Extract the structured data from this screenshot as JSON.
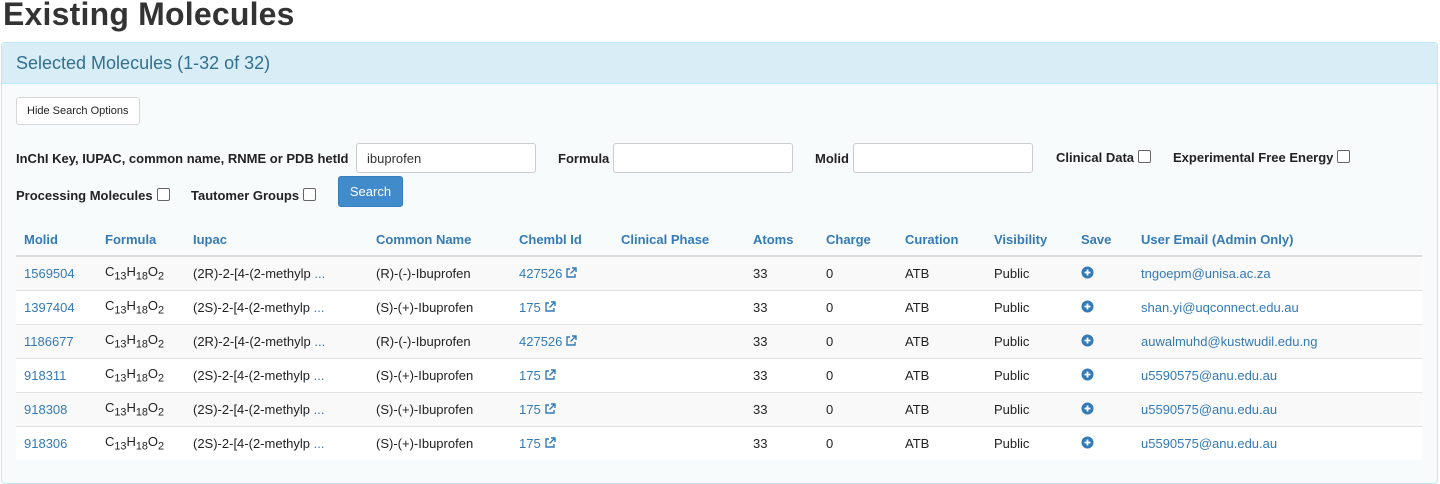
{
  "page_title": "Existing Molecules",
  "panel": {
    "heading": "Selected Molecules (1-32 of 32)"
  },
  "search": {
    "hide_button": "Hide Search Options",
    "query_label": "InChI Key, IUPAC, common name, RNME or PDB hetId",
    "query_value": "ibuprofen",
    "formula_label": "Formula",
    "formula_value": "",
    "molid_label": "Molid",
    "molid_value": "",
    "clinical_label": "Clinical Data",
    "free_energy_label": "Experimental Free Energy",
    "processing_label": "Processing Molecules",
    "tautomer_label": "Tautomer Groups",
    "search_button": "Search"
  },
  "table": {
    "headers": [
      "Molid",
      "Formula",
      "Iupac",
      "Common Name",
      "Chembl Id",
      "Clinical Phase",
      "Atoms",
      "Charge",
      "Curation",
      "Visibility",
      "Save",
      "User Email (Admin Only)"
    ],
    "rows": [
      {
        "molid": "1569504",
        "iupac": "(2R)-2-[4-(2-methylp",
        "common": "(R)-(-)-Ibuprofen",
        "chembl": "427526",
        "phase": "",
        "atoms": "33",
        "charge": "0",
        "curation": "ATB",
        "visibility": "Public",
        "email": "tngoepm@unisa.ac.za"
      },
      {
        "molid": "1397404",
        "iupac": "(2S)-2-[4-(2-methylp",
        "common": "(S)-(+)-Ibuprofen",
        "chembl": "175",
        "phase": "",
        "atoms": "33",
        "charge": "0",
        "curation": "ATB",
        "visibility": "Public",
        "email": "shan.yi@uqconnect.edu.au"
      },
      {
        "molid": "1186677",
        "iupac": "(2R)-2-[4-(2-methylp",
        "common": "(R)-(-)-Ibuprofen",
        "chembl": "427526",
        "phase": "",
        "atoms": "33",
        "charge": "0",
        "curation": "ATB",
        "visibility": "Public",
        "email": "auwalmuhd@kustwudil.edu.ng"
      },
      {
        "molid": "918311",
        "iupac": "(2S)-2-[4-(2-methylp",
        "common": "(S)-(+)-Ibuprofen",
        "chembl": "175",
        "phase": "",
        "atoms": "33",
        "charge": "0",
        "curation": "ATB",
        "visibility": "Public",
        "email": "u5590575@anu.edu.au"
      },
      {
        "molid": "918308",
        "iupac": "(2S)-2-[4-(2-methylp",
        "common": "(S)-(+)-Ibuprofen",
        "chembl": "175",
        "phase": "",
        "atoms": "33",
        "charge": "0",
        "curation": "ATB",
        "visibility": "Public",
        "email": "u5590575@anu.edu.au"
      },
      {
        "molid": "918306",
        "iupac": "(2S)-2-[4-(2-methylp",
        "common": "(S)-(+)-Ibuprofen",
        "chembl": "175",
        "phase": "",
        "atoms": "33",
        "charge": "0",
        "curation": "ATB",
        "visibility": "Public",
        "email": "u5590575@anu.edu.au"
      }
    ],
    "formula": {
      "c": "C",
      "c_sub": "13",
      "h": "H",
      "h_sub": "18",
      "o": "O",
      "o_sub": "2"
    },
    "ellipsis": "..."
  },
  "colors": {
    "link": "#337ab7",
    "heading_bg": "#d9edf7",
    "heading_text": "#31708f",
    "search_button": "#428bca"
  },
  "icons": {
    "external": "external-link-icon",
    "save": "plus-circle-icon"
  }
}
